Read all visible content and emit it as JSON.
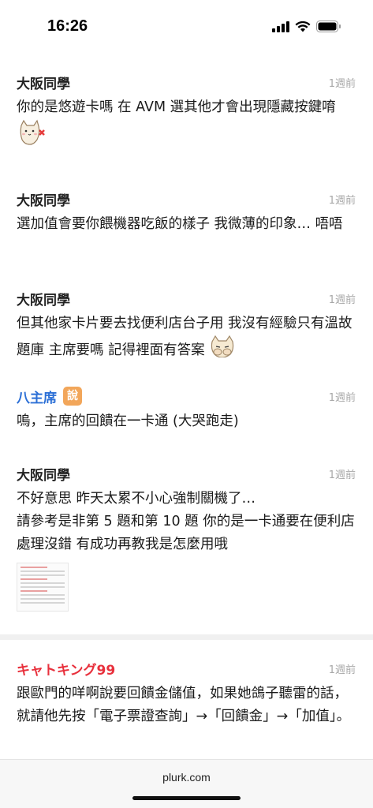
{
  "status": {
    "time": "16:26"
  },
  "posts": [
    {
      "author": "大阪同學",
      "time": "1週前",
      "text": "你的是悠遊卡嗎 在 AVM 選其他才會出現隱藏按鍵唷"
    },
    {
      "author": "大阪同學",
      "time": "1週前",
      "text": "選加值會要你餵機器吃飯的樣子 我微薄的印象… 唔唔"
    },
    {
      "author": "大阪同學",
      "time": "1週前",
      "text": "但其他家卡片要去找便利店台子用 我沒有經驗只有溫故題庫 主席要嗎 記得裡面有答案"
    },
    {
      "author": "八主席",
      "badge": "說",
      "time": "1週前",
      "text": "嗚，主席的回饋在一卡通 (大哭跑走)"
    },
    {
      "author": "大阪同學",
      "time": "1週前",
      "text1": "不好意思 昨天太累不小心強制關機了…",
      "text2": "請參考是非第 5 題和第 10 題 你的是一卡通要在便利店處理沒錯 有成功再教我是怎麼用哦"
    },
    {
      "author": "キャトキング99",
      "time": "1週前",
      "text": "跟歐門的咩啊說要回饋金儲值，如果她鴿子聽雷的話，就請他先按「電子票證查詢」→「回饋金」→「加值」。"
    }
  ],
  "footer": {
    "domain": "plurk.com"
  },
  "colors": {
    "accent_blue": "#2b6fd6",
    "accent_red": "#e8303c",
    "badge_orange": "#f2a65a"
  }
}
